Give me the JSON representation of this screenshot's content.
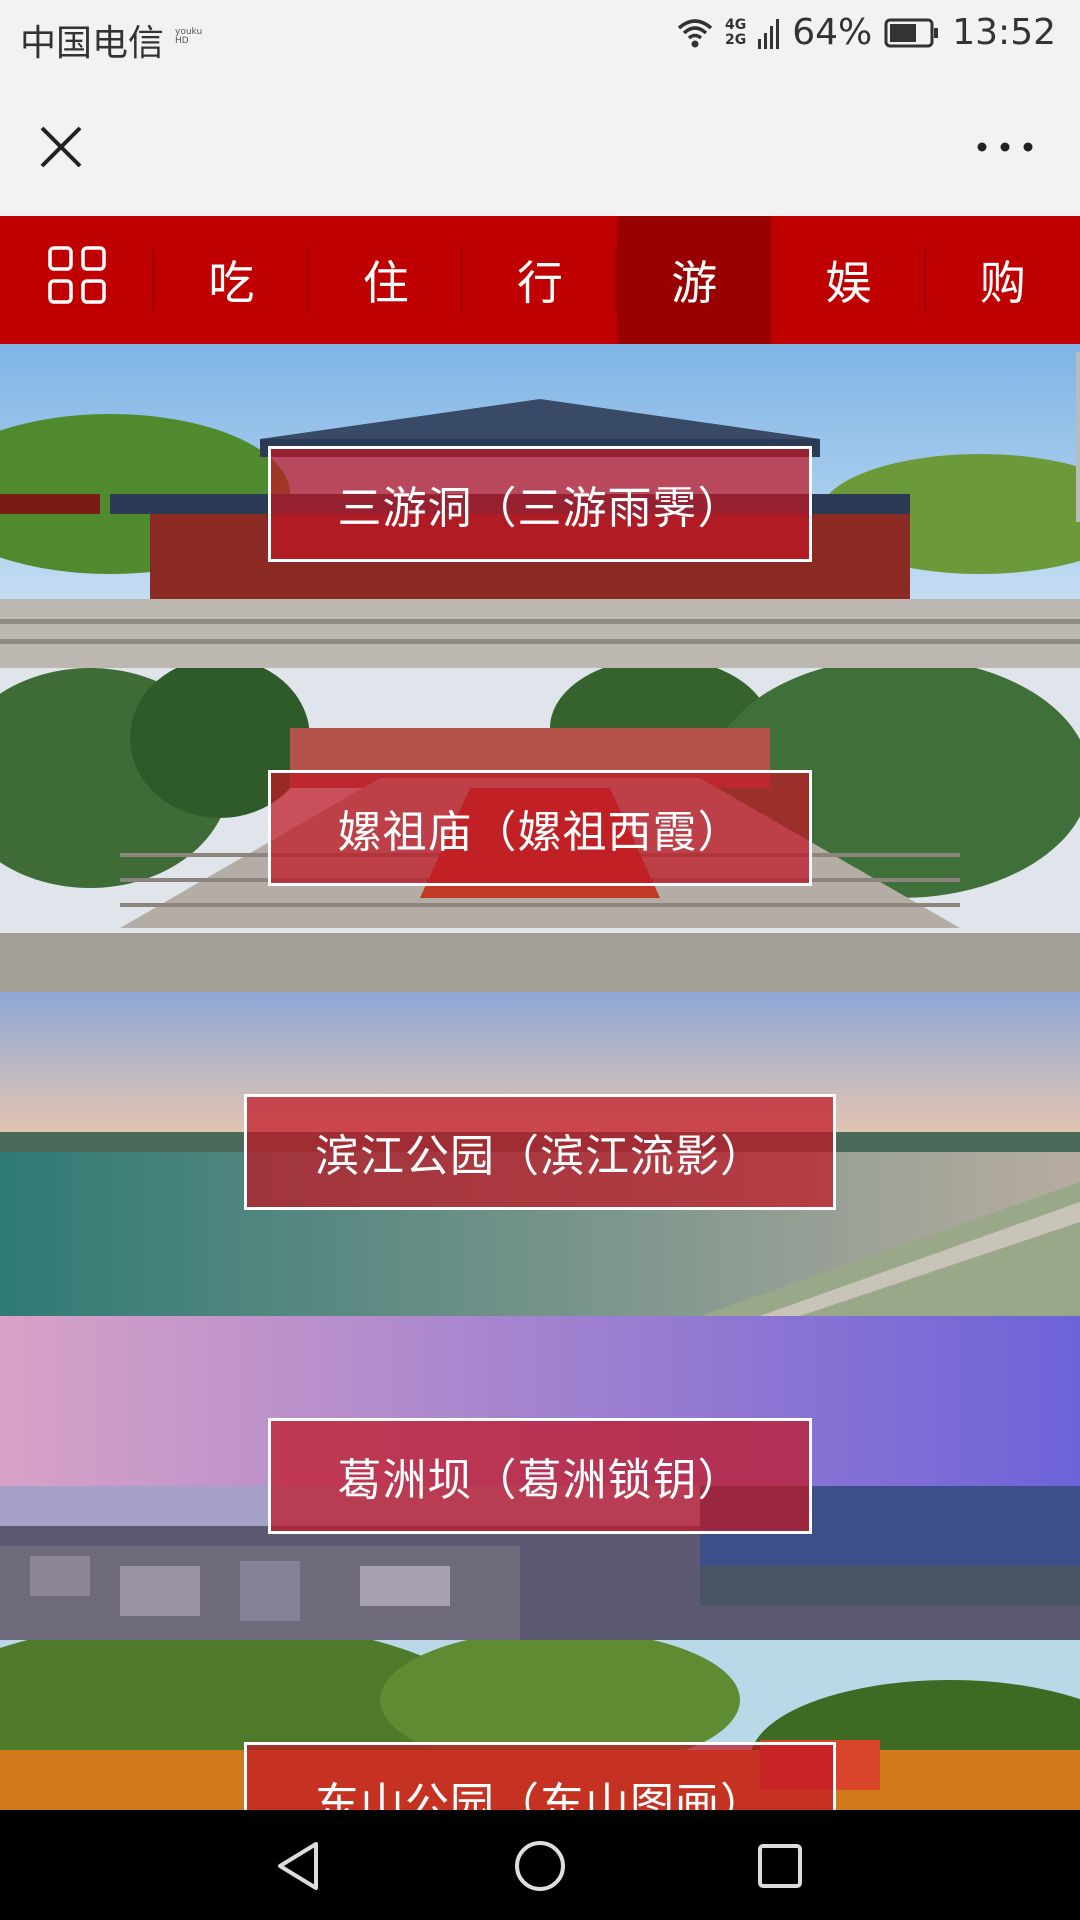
{
  "status": {
    "carrier": "中国电信",
    "carrier_mini_top": "youku",
    "carrier_mini_bottom": "HD",
    "net_top": "4G",
    "net_bottom": "2G",
    "battery": "64%",
    "time": "13:52",
    "icons": [
      "wifi-icon",
      "signal-icon",
      "battery-icon"
    ]
  },
  "titlebar": {
    "icons": [
      "close-icon",
      "more-icon"
    ]
  },
  "nav": {
    "menu_icon": "grid-icon",
    "items": [
      {
        "label": "吃"
      },
      {
        "label": "住"
      },
      {
        "label": "行"
      },
      {
        "label": "游",
        "active": true
      },
      {
        "label": "娱"
      },
      {
        "label": "购"
      }
    ]
  },
  "spots": [
    {
      "label": "三游洞（三游雨霁）"
    },
    {
      "label": "嫘祖庙（嫘祖西霞）"
    },
    {
      "label": "滨江公园（滨江流影）"
    },
    {
      "label": "葛洲坝（葛洲锁钥）"
    },
    {
      "label": "东山公园（东山图画）"
    }
  ],
  "system_nav": {
    "icons": [
      "back-icon",
      "home-icon",
      "recents-icon"
    ]
  },
  "colors": {
    "nav_bg": "#c00000",
    "nav_active": "#990000",
    "label_bg": "rgba(192,22,36,0.72)"
  }
}
